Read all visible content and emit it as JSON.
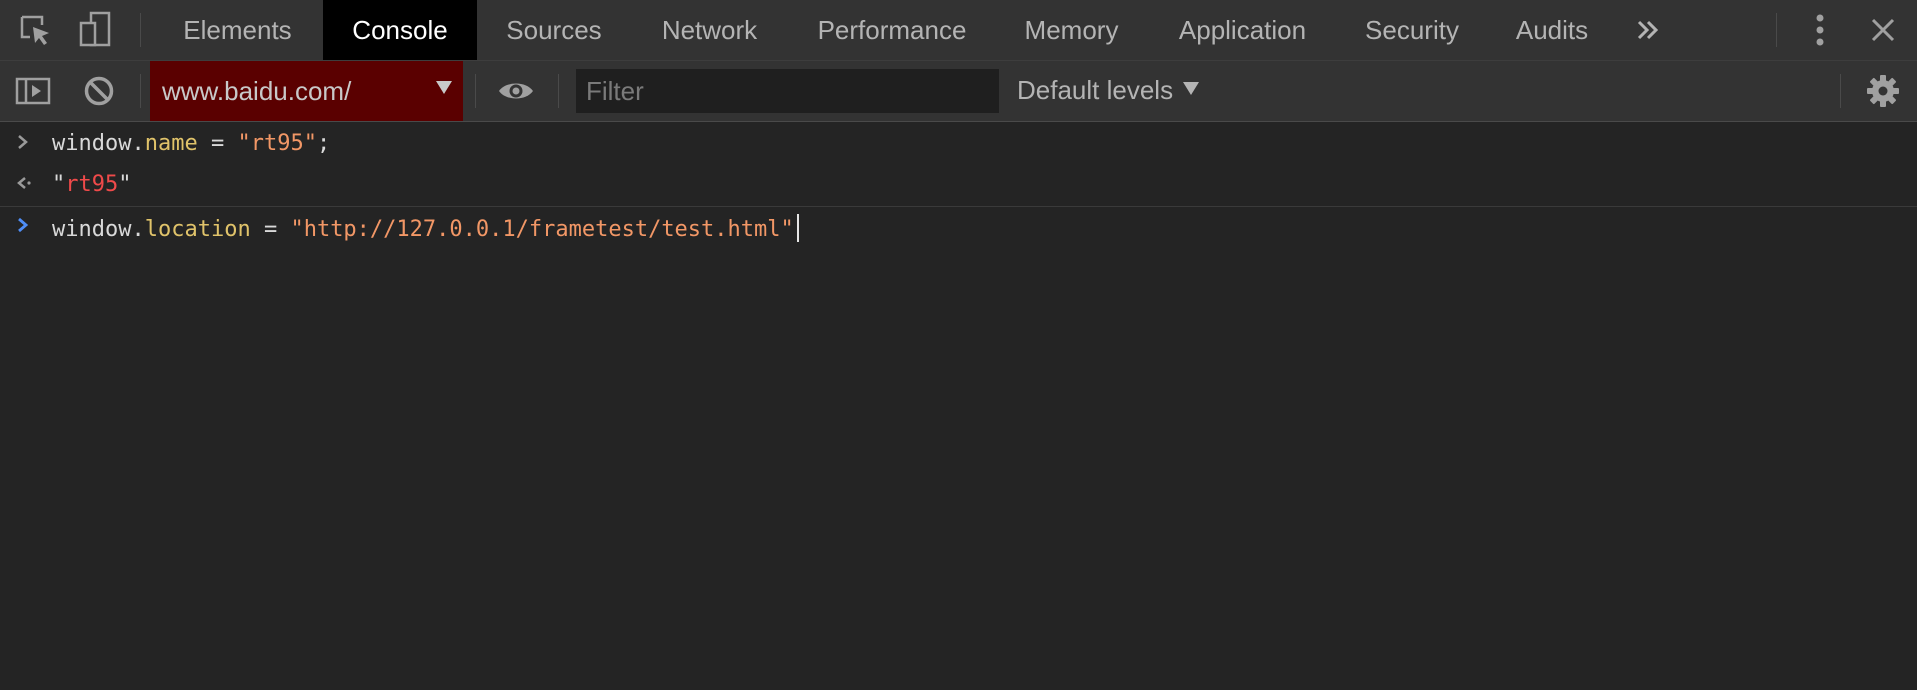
{
  "tabs": [
    {
      "label": "Elements",
      "active": false
    },
    {
      "label": "Console",
      "active": true
    },
    {
      "label": "Sources",
      "active": false
    },
    {
      "label": "Network",
      "active": false
    },
    {
      "label": "Performance",
      "active": false
    },
    {
      "label": "Memory",
      "active": false
    },
    {
      "label": "Application",
      "active": false
    },
    {
      "label": "Security",
      "active": false
    },
    {
      "label": "Audits",
      "active": false
    }
  ],
  "tabbar_icons": [
    "inspect-element-icon",
    "device-toolbar-icon",
    "more-tabs-icon",
    "more-options-icon",
    "close-icon"
  ],
  "toolbar": {
    "context": "www.baidu.com/",
    "filter": {
      "placeholder": "Filter",
      "value": ""
    },
    "levels": "Default levels"
  },
  "console": {
    "entries": [
      {
        "kind": "input",
        "object": "window",
        "dot": ".",
        "property": "name",
        "assign": " = ",
        "string": "\"rt95\"",
        "tail": ";"
      },
      {
        "kind": "result",
        "quote_open": "\"",
        "value": "rt95",
        "quote_close": "\""
      },
      {
        "kind": "active-input",
        "object": "window",
        "dot": ".",
        "property": "location",
        "assign": " = ",
        "string": "\"http://127.0.0.1/frametest/test.html\""
      }
    ]
  },
  "colors": {
    "background": "#242424",
    "toolbar": "#333333",
    "active_tab": "#000000",
    "context_bg": "#5a0000",
    "property": "#e0c36a",
    "string": "#f29766",
    "result_string": "#f04a4a",
    "prompt_active": "#4f8ef7"
  }
}
